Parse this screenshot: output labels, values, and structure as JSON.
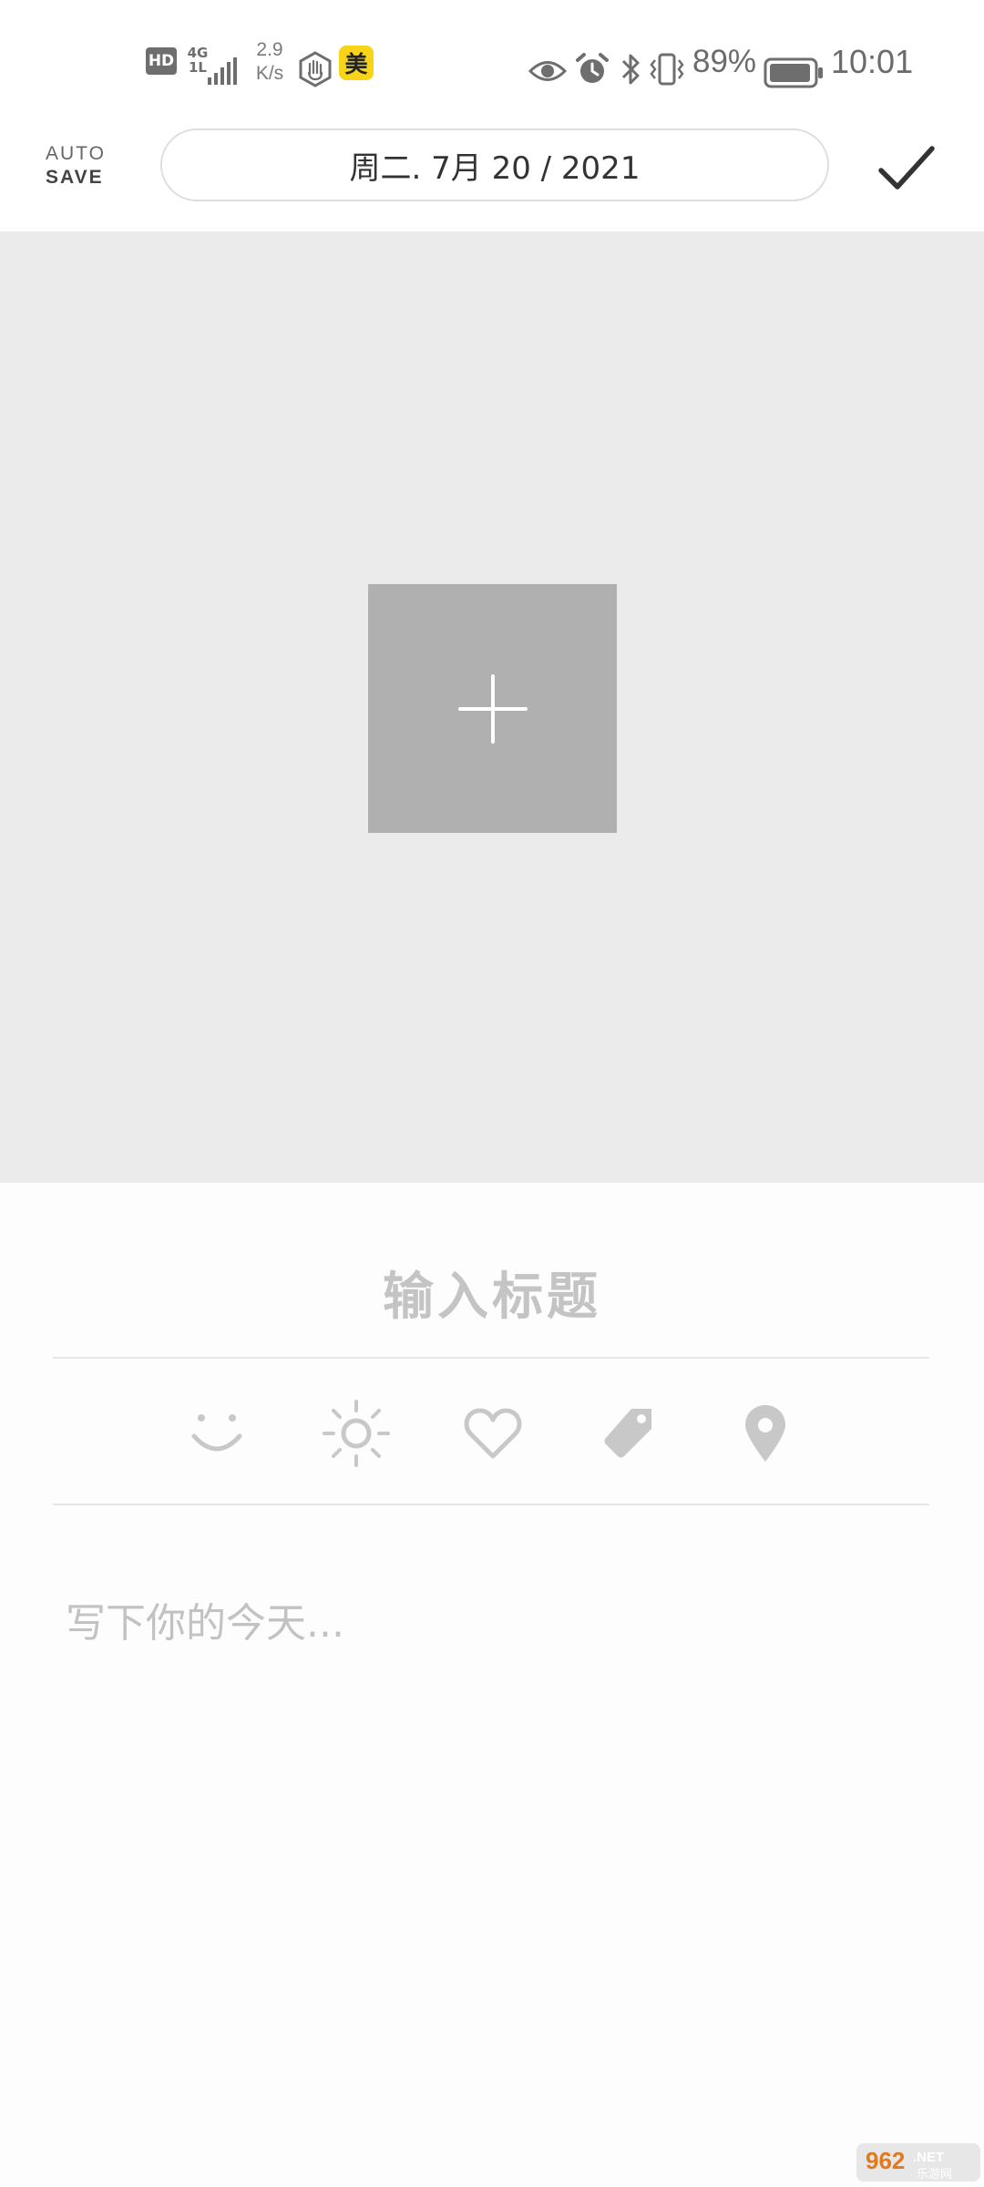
{
  "status_bar": {
    "hd_badge": "HD",
    "network_type": "4G",
    "network_sub": "1L",
    "speed_value": "2.9",
    "speed_unit": "K/s",
    "app_badge": "美",
    "battery_percent": "89%",
    "time": "10:01",
    "icons": [
      "signal-icon",
      "hand-icon",
      "eye-icon",
      "alarm-icon",
      "bluetooth-icon",
      "vibrate-icon",
      "battery-icon"
    ]
  },
  "toolbar": {
    "autosave_line1": "AUTO",
    "autosave_line2": "SAVE",
    "date_text": "周二. 7月 20 / 2021",
    "confirm_icon": "checkmark-icon"
  },
  "photo": {
    "add_icon": "plus-icon"
  },
  "entry": {
    "title_placeholder": "输入标题",
    "body_placeholder": "写下你的今天...",
    "meta_icons": [
      "smile-icon",
      "sun-icon",
      "heart-icon",
      "tag-icon",
      "location-pin-icon"
    ]
  },
  "watermark": {
    "text": "962.NET",
    "sub": "乐游网"
  },
  "colors": {
    "photo_bg": "#ebebeb",
    "add_tile": "#b0b0b0",
    "placeholder": "#c4c4c4",
    "icon_gray": "#c8c8c8",
    "divider": "#e6e6e6"
  }
}
